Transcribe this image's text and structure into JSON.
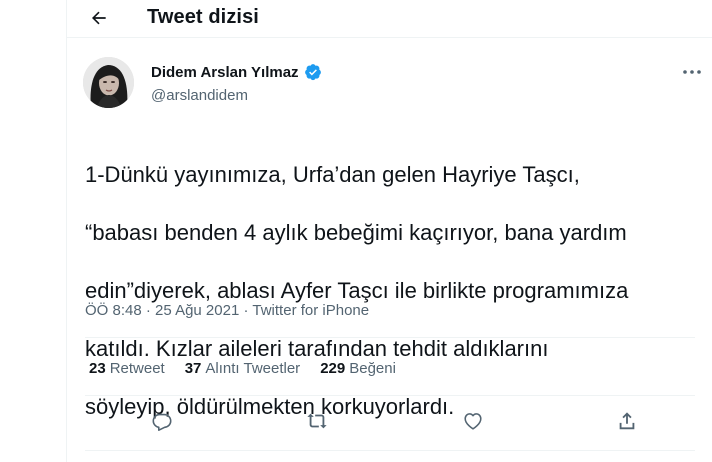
{
  "header": {
    "title": "Tweet dizisi",
    "back_icon": "arrow-left-icon"
  },
  "author": {
    "name": "Didem Arslan Yılmaz",
    "handle": "@arslandidem",
    "verified_color": "#1d9bf0"
  },
  "tweet": {
    "lines": [
      "1-Dünkü yayınımıza, Urfa’dan gelen Hayriye Taşcı,",
      "“babası benden 4 aylık bebeğimi kaçırıyor, bana yardım",
      "edin”diyerek, ablası Ayfer Taşcı ile birlikte programımıza",
      "katıldı. Kızlar aileleri tarafından tehdit aldıklarını",
      "söyleyip, öldürülmekten korkuyorlardı."
    ],
    "time": "ÖÖ 8:48",
    "separator": "·",
    "date": "25 Ağu 2021",
    "source": "Twitter for iPhone"
  },
  "stats": {
    "retweets": {
      "count": "23",
      "label": "Retweet"
    },
    "quotes": {
      "count": "37",
      "label": "Alıntı Tweetler"
    },
    "likes": {
      "count": "229",
      "label": "Beğeni"
    }
  },
  "actions": [
    "reply-icon",
    "retweet-icon",
    "like-icon",
    "share-icon"
  ],
  "colors": {
    "text": "#0f1419",
    "secondary": "#536471",
    "border": "#eff3f4",
    "accent": "#1d9bf0"
  }
}
